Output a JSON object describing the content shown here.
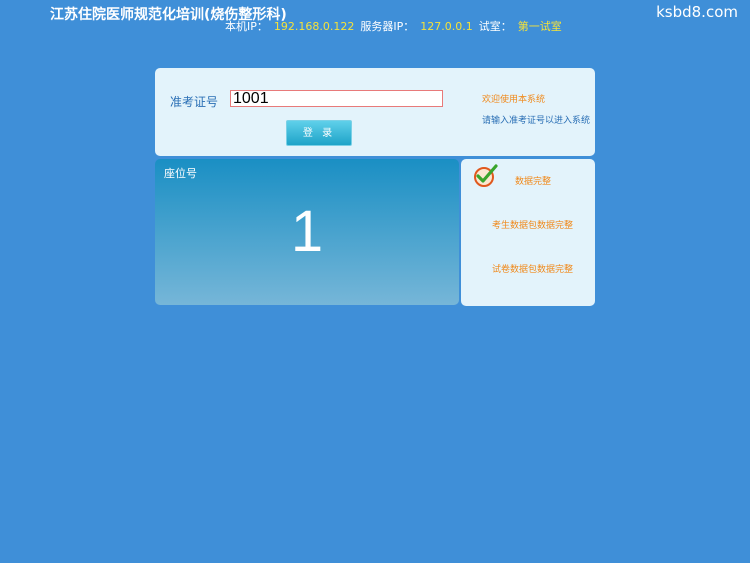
{
  "header": {
    "title": "江苏住院医师规范化培训(烧伤整形科)",
    "site_mark": "ksbd8.com",
    "local_ip_label": "本机IP：",
    "local_ip": "192.168.0.122",
    "server_ip_label": "服务器IP：",
    "server_ip": "127.0.0.1",
    "room_label": "试室：",
    "room": "第一试室"
  },
  "login": {
    "ticket_label": "准考证号",
    "ticket_value": "1001",
    "login_button": "登 录",
    "welcome": "欢迎使用本系统",
    "prompt": "请输入准考证号以进入系统"
  },
  "seat": {
    "label": "座位号",
    "number": "1"
  },
  "status": {
    "icon": "check-icon",
    "items": [
      "数据完整",
      "考生数据包数据完整",
      "试卷数据包数据完整"
    ]
  },
  "colors": {
    "background": "#3f8fd8",
    "highlight": "#f5e23a",
    "accent": "#f08a1c"
  }
}
